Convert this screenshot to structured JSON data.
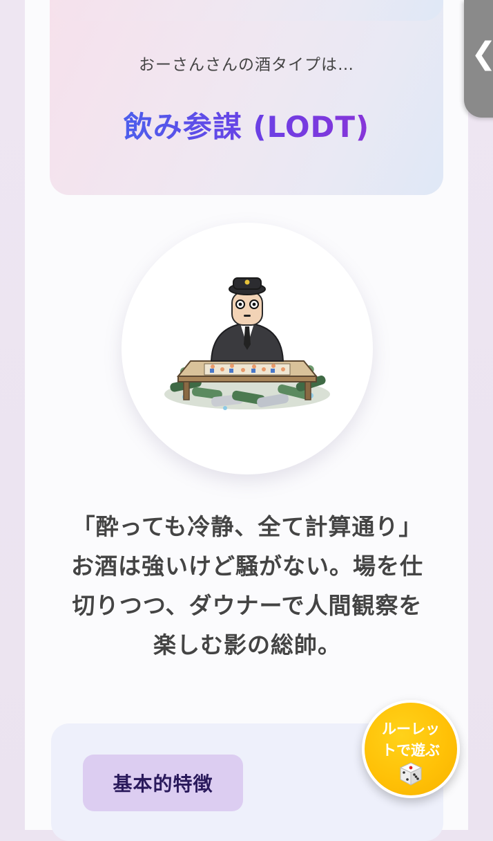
{
  "result": {
    "subtitle": "おーさんさんの酒タイプは…",
    "type_title": "飲み参謀 (LODT)"
  },
  "illustration": {
    "icon": "strategist-with-bottles-illustration"
  },
  "description": {
    "lines": [
      "「酔っても冷静、全て計算通り」",
      "お酒は強いけど騒がない。場を仕",
      "切りつつ、ダウナーで人間観察を",
      "楽しむ影の総帥。"
    ]
  },
  "features": {
    "heading": "基本的特徴"
  },
  "side_tab": {
    "icon": "chevron-left-icon",
    "glyph": "❮"
  },
  "roulette_button": {
    "line1": "ルーレッ",
    "line2": "トで遊ぶ",
    "icon": "dice-icon"
  },
  "colors": {
    "title_gradient_start": "#3b6ff0",
    "title_gradient_end": "#9a2fd0",
    "roulette_button": "#ffc107",
    "features_chip": "#dccdf1"
  }
}
